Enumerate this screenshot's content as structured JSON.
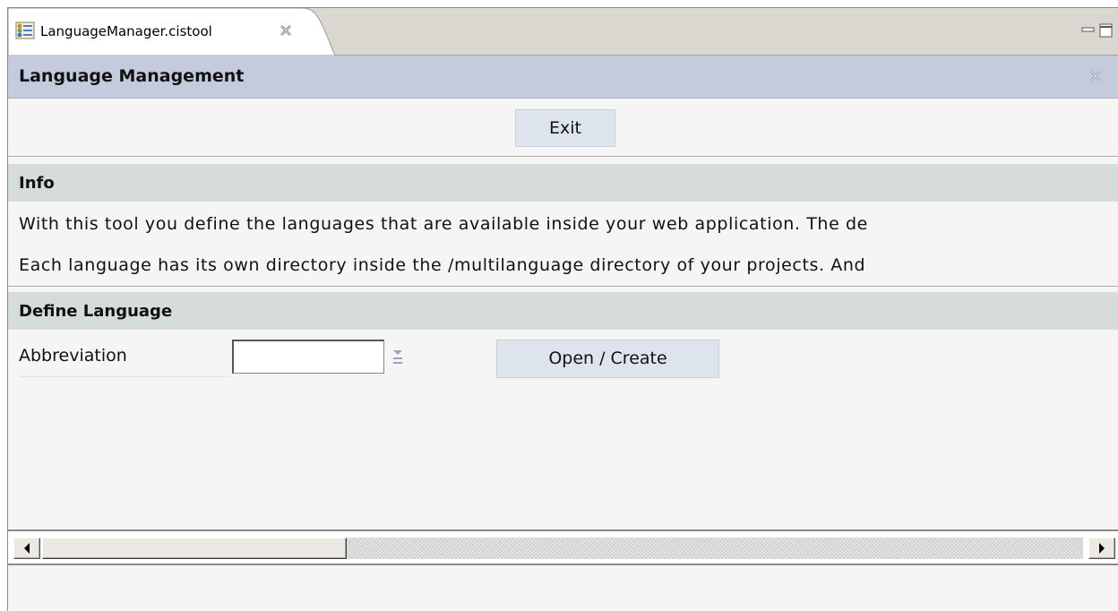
{
  "tab": {
    "label": "LanguageManager.cistool",
    "icon": "cistool-file-icon",
    "close_icon": "close-x-icon"
  },
  "window_controls": {
    "minimize_icon": "minimize-icon",
    "maximize_icon": "maximize-icon"
  },
  "header": {
    "title": "Language Management",
    "close_icon": "close-x-icon"
  },
  "toolbar": {
    "exit_label": "Exit"
  },
  "info": {
    "title": "Info",
    "lines": [
      "With this tool you define the languages that are available inside your web application. The de",
      "Each language has its own directory inside the /multilanguage directory of your projects. And"
    ]
  },
  "define_language": {
    "title": "Define Language",
    "abbreviation_label": "Abbreviation",
    "abbreviation_value": "",
    "open_create_label": "Open / Create"
  },
  "colors": {
    "tabstrip": "#dad7d0",
    "header": "#c4cbdc",
    "section_header": "#d6dcdc",
    "button": "#dde4ec",
    "background": "#f5f5f5"
  }
}
